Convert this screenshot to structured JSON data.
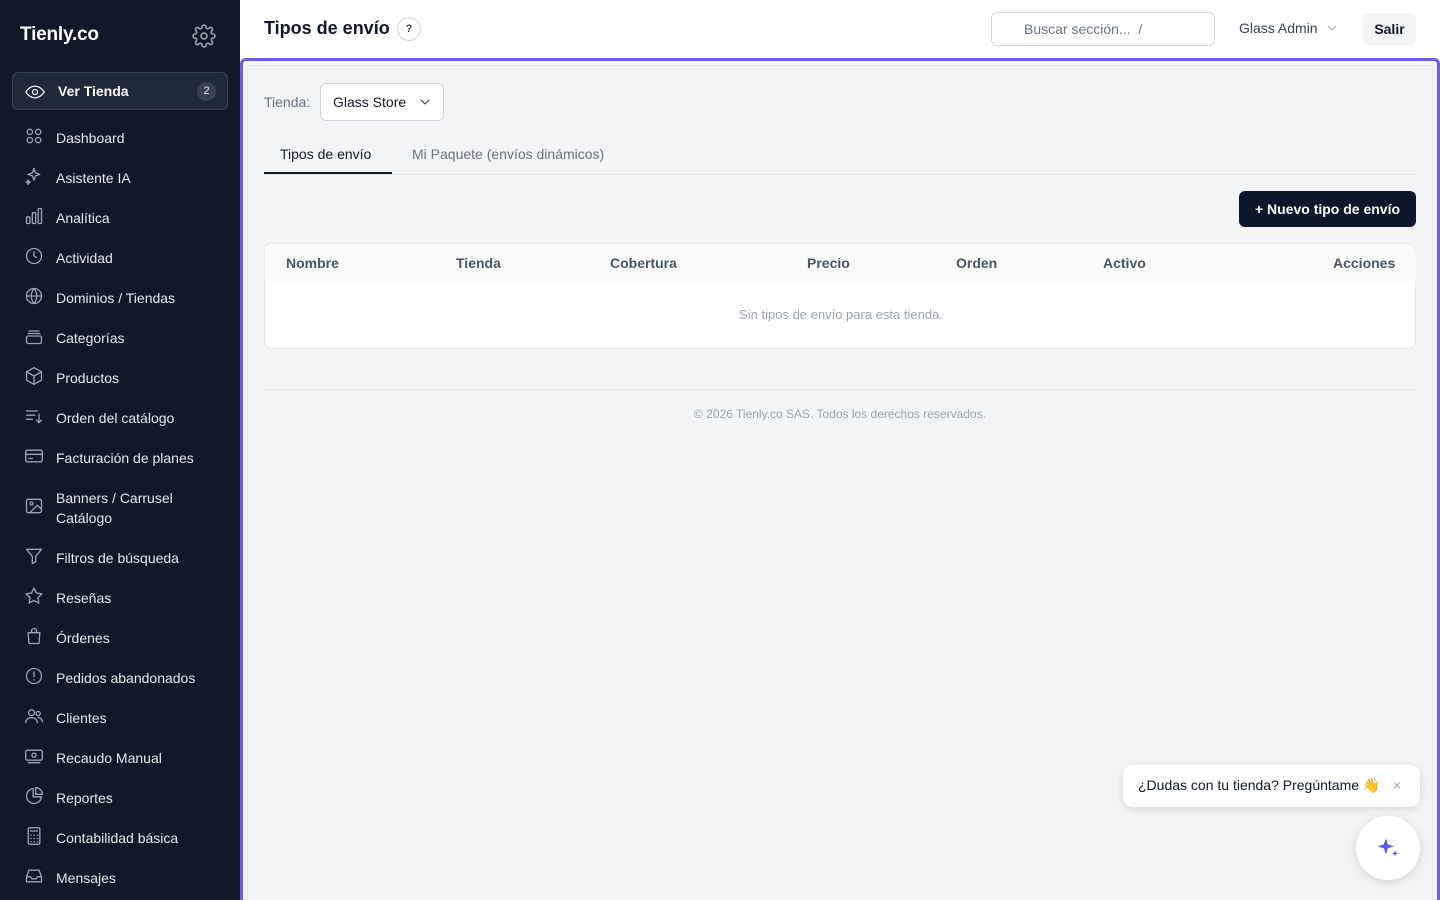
{
  "app": {
    "brand": "Tienly.co"
  },
  "sidebar": {
    "ver_tienda": {
      "label": "Ver Tienda",
      "badge": "2"
    },
    "items": [
      {
        "label": "Dashboard",
        "icon": "dashboard-grid-icon"
      },
      {
        "label": "Asistente IA",
        "icon": "sparkles-icon"
      },
      {
        "label": "Analítica",
        "icon": "bar-chart-icon"
      },
      {
        "label": "Actividad",
        "icon": "clock-icon"
      },
      {
        "label": "Dominios / Tiendas",
        "icon": "globe-icon"
      },
      {
        "label": "Categorías",
        "icon": "layers-icon"
      },
      {
        "label": "Productos",
        "icon": "box-icon"
      },
      {
        "label": "Orden del catálogo",
        "icon": "sort-list-icon"
      },
      {
        "label": "Facturación de planes",
        "icon": "credit-card-icon"
      },
      {
        "label": "Banners / Carrusel Catálogo",
        "icon": "image-icon"
      },
      {
        "label": "Filtros de búsqueda",
        "icon": "filter-icon"
      },
      {
        "label": "Reseñas",
        "icon": "star-icon"
      },
      {
        "label": "Órdenes",
        "icon": "shopping-bag-icon"
      },
      {
        "label": "Pedidos abandonados",
        "icon": "alert-circle-icon"
      },
      {
        "label": "Clientes",
        "icon": "users-icon"
      },
      {
        "label": "Recaudo Manual",
        "icon": "cash-icon"
      },
      {
        "label": "Reportes",
        "icon": "pie-chart-icon"
      },
      {
        "label": "Contabilidad básica",
        "icon": "calculator-icon"
      },
      {
        "label": "Mensajes",
        "icon": "inbox-icon"
      }
    ]
  },
  "header": {
    "title": "Tipos de envío",
    "help": "?",
    "search_placeholder": "Buscar sección...  /",
    "user": "Glass Admin",
    "logout": "Salir"
  },
  "filters": {
    "store_label": "Tienda:",
    "store_value": "Glass Store"
  },
  "tabs": [
    {
      "label": "Tipos de envío",
      "active": true
    },
    {
      "label": "Mi Paquete (envíos dinámicos)",
      "active": false
    }
  ],
  "actions": {
    "new_button": "+ Nuevo tipo de envío"
  },
  "table": {
    "columns": [
      "Nombre",
      "Tienda",
      "Cobertura",
      "Precio",
      "Orden",
      "Activo",
      "Acciones"
    ],
    "rows": [],
    "empty_text": "Sin tipos de envío para esta tienda."
  },
  "footer": {
    "text": "© 2026 Tienly.co SAS. Todos los derechos reservados."
  },
  "chat": {
    "prompt": "¿Dudas con tu tienda? Pregúntame 👋",
    "close": "×"
  },
  "colors": {
    "sidebar_bg": "#111827",
    "accent_frame": "#6d5ee8",
    "primary_button": "#0f172a",
    "fab_icon": "#5b5ce6"
  }
}
